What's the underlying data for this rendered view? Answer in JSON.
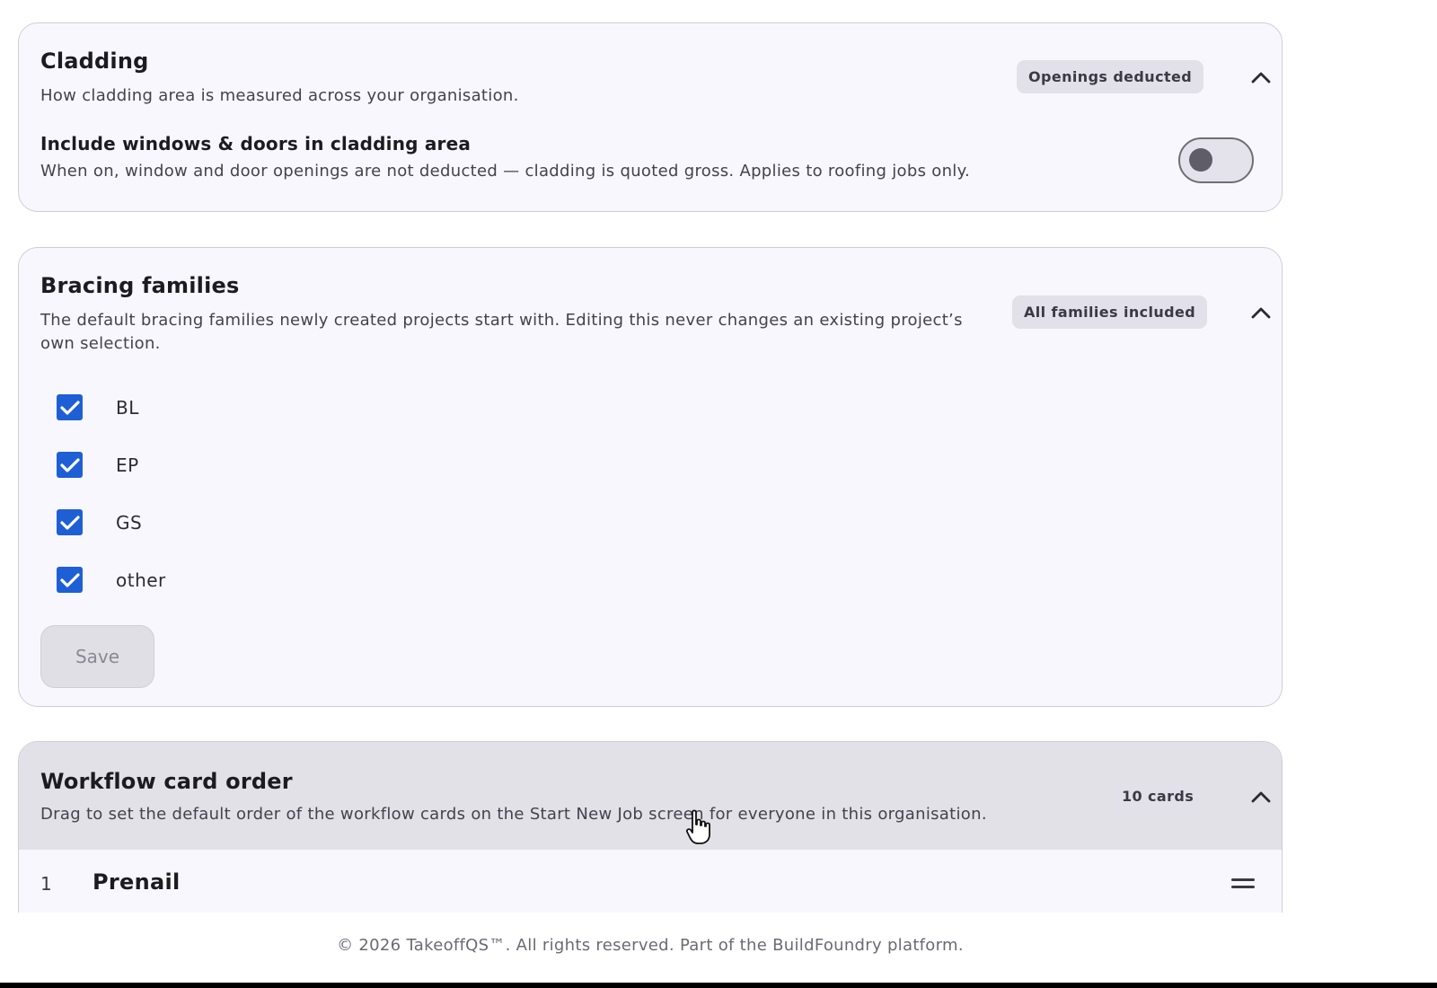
{
  "cladding": {
    "title": "Cladding",
    "description": "How cladding area is measured across your organisation.",
    "badge": "Openings deducted",
    "setting_label": "Include windows & doors in cladding area",
    "setting_description": "When on, window and door openings are not deducted — cladding is quoted gross. Applies to roofing jobs only.",
    "toggle_on": false
  },
  "bracing": {
    "title": "Bracing families",
    "description": "The default bracing families newly created projects start with. Editing this never changes an existing project’s own selection.",
    "badge": "All families included",
    "families": [
      {
        "label": "BL",
        "checked": true
      },
      {
        "label": "EP",
        "checked": true
      },
      {
        "label": "GS",
        "checked": true
      },
      {
        "label": "other",
        "checked": true
      }
    ],
    "save_label": "Save"
  },
  "workflow": {
    "title": "Workflow card order",
    "description": "Drag to set the default order of the workflow cards on the Start New Job screen for everyone in this organisation.",
    "badge": "10 cards",
    "rows": [
      {
        "number": "1",
        "name": "Prenail"
      }
    ]
  },
  "footer": {
    "text": "© 2026 TakeoffQS™. All rights reserved. Part of the BuildFoundry platform."
  },
  "colors": {
    "accent": "#1f5fd6",
    "card_bg": "#f8f7fd",
    "hover_bg": "#e2e1e7"
  }
}
